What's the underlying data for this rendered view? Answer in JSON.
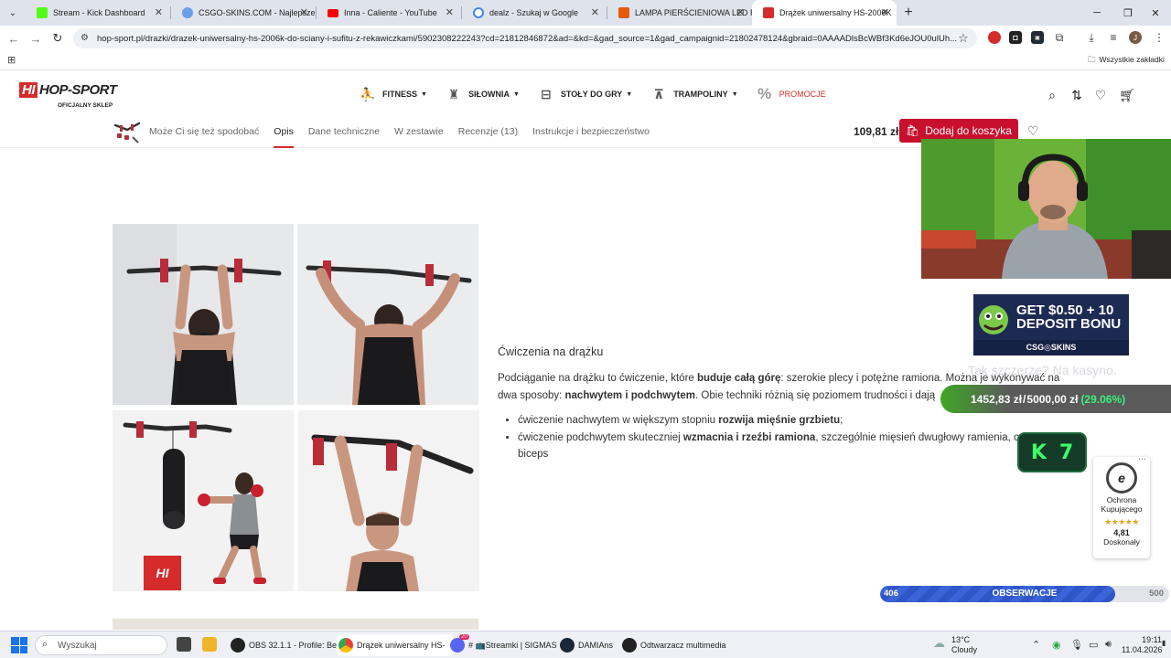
{
  "browser": {
    "tabs": [
      {
        "title": "Stream - Kick Dashboard",
        "color": "#53fc18"
      },
      {
        "title": "CSGO-SKINS.COM - Najlepsze",
        "color": "#6aa0e8"
      },
      {
        "title": "Inna - Caliente - YouTube",
        "color": "#ff0000"
      },
      {
        "title": "dealz - Szukaj w Google",
        "color": "#4285f4"
      },
      {
        "title": "LAMPA PIERŚCIENIOWA LED RI",
        "color": "#e8590c"
      },
      {
        "title": "Drążek uniwersalny HS-2006K",
        "color": "#d52b2b"
      }
    ],
    "url": "hop-sport.pl/drazki/drazek-uniwersalny-hs-2006k-do-sciany-i-sufitu-z-rekawiczkami/5902308222243?cd=21812846872&ad=&kd=&gad_source=1&gad_campaignid=21802478124&gbraid=0AAAADlsBcWBf3Kd6eJOU0ulUh...",
    "bookmarks_label": "Wszystkie zakładki",
    "profile_initial": "J"
  },
  "site": {
    "logo": "HOP-SPORT",
    "logo_mark": "HI",
    "logo_sub": "OFICJALNY SKLEP",
    "nav": [
      {
        "label": "FITNESS",
        "icon": "treadmill-icon"
      },
      {
        "label": "SIŁOWNIA",
        "icon": "gym-icon"
      },
      {
        "label": "STOŁY DO GRY",
        "icon": "game-table-icon"
      },
      {
        "label": "TRAMPOLINY",
        "icon": "trampoline-icon"
      },
      {
        "label": "PROMOCJE",
        "icon": "percent-icon"
      }
    ]
  },
  "product_bar": {
    "tabs": [
      "Może Ci się też spodobać",
      "Opis",
      "Dane techniczne",
      "W zestawie",
      "Recenzje (13)",
      "Instrukcje i bezpieczeństwo"
    ],
    "active_tab": "Opis",
    "price": "109,81 zł",
    "add_to_cart": "Dodaj do koszyka"
  },
  "article": {
    "heading": "Ćwiczenia na drążku",
    "p1_a": "Podciąganie na drążku to ćwiczenie, które ",
    "p1_b": "buduje całą górę",
    "p1_c": ": szerokie plecy i potężne ramiona. Można je wykonywać na dwa sposoby: ",
    "p1_d": "nachwytem i podchwytem",
    "p1_e": ". Obie techniki różnią się poziomem trudności i dają",
    "li1_a": "ćwiczenie nachwytem w większym stopniu ",
    "li1_b": "rozwija mięśnie grzbietu",
    "li1_c": ";",
    "li2_a": "ćwiczenie podchwytem skuteczniej ",
    "li2_b": "wzmacnia i rzeźbi ramiona",
    "li2_c": ", szczególnie mięsień dwugłowy ramienia, cz",
    "li2_d": "biceps"
  },
  "photo_badge": "HI",
  "overlay": {
    "ad_line1": "GET $0.50 + 10",
    "ad_line2": "DEPOSIT BONU",
    "ad_brand": "CSG◎SKINS",
    "ghost": "Tak szczerze? Na kasyno.",
    "balance_a": "1452,83 zł",
    "balance_sep": "/",
    "balance_b": "5000,00 zł",
    "balance_pct": "(29.06%)",
    "k_letter": "K",
    "k_number": "7",
    "progress_current": "406",
    "progress_label": "OBSERWACJE",
    "progress_goal": "500",
    "progress_fraction": 0.812
  },
  "trusted": {
    "seal": "e",
    "line1": "Ochrona",
    "line2": "Kupującego",
    "stars": "★★★★★",
    "score": "4,81",
    "verdict": "Doskonały"
  },
  "taskbar": {
    "search_placeholder": "Wyszukaj",
    "items": [
      "OBS 32.1.1 - Profile: Bez",
      "Drążek uniwersalny HS-",
      "# 📺Streamki | SIGMAS",
      "DAMIAns",
      "Odtwarzacz multimedia"
    ],
    "discord_badge": "20",
    "weather_temp": "13°C",
    "weather_desc": "Cloudy",
    "time": "19:11",
    "date": "11.04.2026"
  }
}
